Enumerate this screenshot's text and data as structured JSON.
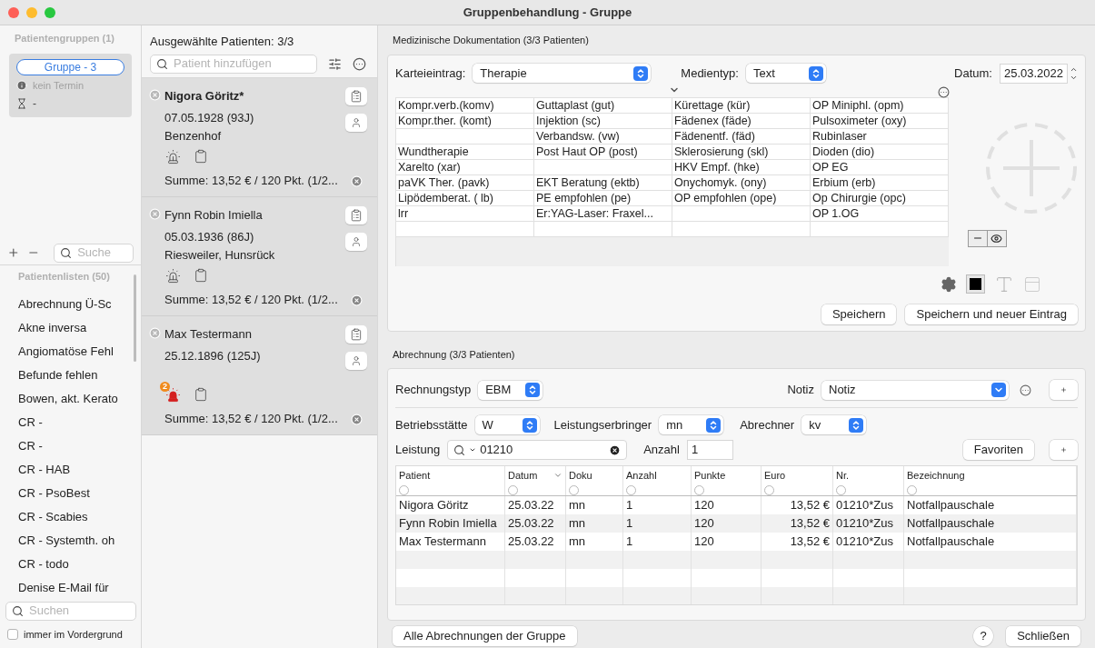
{
  "window": {
    "title": "Gruppenbehandlung - Gruppe"
  },
  "groups": {
    "header": "Patientengruppen (1)",
    "search_placeholder": "Suche",
    "items": [
      {
        "name": "Gruppe - 3",
        "selected": true,
        "appointment": "kein Termin",
        "info": "-"
      }
    ]
  },
  "lists": {
    "header": "Patientenlisten (50)",
    "search_placeholder": "Suchen",
    "items": [
      "Abrechnung Ü-Sc",
      "Akne inversa",
      "Angiomatöse Fehl",
      "Befunde fehlen",
      "Bowen, akt. Kerato",
      "CR -",
      "CR -",
      "CR - HAB",
      "CR - PsoBest",
      "CR - Scabies",
      "CR - Systemth. oh",
      "CR - todo",
      "Denise E-Mail für"
    ]
  },
  "always_on_top": {
    "label": "immer im Vordergrund",
    "checked": false
  },
  "selected_patients": {
    "title": "Ausgewählte Patienten: 3/3",
    "search_placeholder": "Patient hinzufügen",
    "patients": [
      {
        "name": "Nigora Göritz*",
        "selected": true,
        "birth": "07.05.1928 (93J)",
        "place": "Benzenhof",
        "alarm": false,
        "sum": "Summe: 13,52 € / 120 Pkt. (1/2..."
      },
      {
        "name": "Fynn Robin Imiella",
        "selected": false,
        "birth": "05.03.1936 (86J)",
        "place": "Riesweiler, Hunsrück",
        "alarm": false,
        "sum": "Summe: 13,52 € / 120 Pkt. (1/2..."
      },
      {
        "name": "Max Testermann",
        "selected": false,
        "birth": "25.12.1896 (125J)",
        "alarm": true,
        "alarm_count": "2",
        "sum": "Summe: 13,52 € / 120 Pkt. (1/2..."
      }
    ]
  },
  "documentation": {
    "title": "Medizinische Dokumentation (3/3 Patienten)",
    "entry_label": "Karteieintrag:",
    "entry_value": "Therapie",
    "media_label": "Medientyp:",
    "media_value": "Text",
    "date_label": "Datum:",
    "date_value": "25.03.2022",
    "shortcuts": [
      {
        "column_1": "Kompr.verb.(komv)",
        "column_2": "Guttaplast (gut)",
        "column_3": "Kürettage (kür)",
        "column_4": "OP Miniphl. (opm)"
      },
      {
        "column_1": "Kompr.ther. (komt)",
        "column_2": "Injektion (sc)",
        "column_3": "Fädenex (fäde)",
        "column_4": "Pulsoximeter (oxy)"
      },
      {
        "column_2": "Verbandsw. (vw)",
        "column_3": "Fädenentf. (fäd)",
        "column_4": "Rubinlaser"
      },
      {
        "column_1": "Wundtherapie",
        "column_2": "Post Haut OP (post)",
        "column_3": "Sklerosierung (skl)",
        "column_4": "Dioden (dio)"
      },
      {
        "column_1": "Xarelto (xar)",
        "column_3": "HKV Empf. (hke)",
        "column_4": "OP EG"
      },
      {
        "column_1": "paVK Ther. (pavk)",
        "column_2": "EKT Beratung (ektb)",
        "column_3": "Onychomyk. (ony)",
        "column_4": "Erbium (erb)"
      },
      {
        "column_1": "Lipödemberat. ( lb)",
        "column_2": "PE empfohlen (pe)",
        "column_3": "OP empfohlen (ope)",
        "column_4": "Op Chirurgie (opc)"
      },
      {
        "column_1": "lrr",
        "column_2": "Er:YAG-Laser: Fraxel...",
        "column_4": "OP 1.OG"
      }
    ],
    "buttons": [
      "Speichern",
      "Speichern und neuer Eintrag"
    ]
  },
  "billing": {
    "title": "Abrechnung (3/3 Patienten)",
    "invoice_type_label": "Rechnungstyp",
    "invoice_type": "EBM",
    "note_label": "Notiz",
    "note_value": "Notiz",
    "site_label": "Betriebsstätte",
    "site": "W",
    "provider_label": "Leistungserbringer",
    "provider": "mn",
    "biller_label": "Abrechner",
    "biller": "kv",
    "service_label": "Leistung",
    "service_value": "01210",
    "count_label": "Anzahl",
    "count_value": "1",
    "favorites": "Favoriten",
    "table": {
      "columns": [
        "Patient",
        "Datum",
        "Doku",
        "Anzahl",
        "Punkte",
        "Euro",
        "Nr.",
        "Bezeichnung"
      ],
      "rows": [
        [
          "Nigora Göritz",
          "25.03.22",
          "mn",
          "1",
          "120",
          "13,52 €",
          "01210*Zus",
          "Notfallpauschale"
        ],
        [
          "Fynn Robin Imiella",
          "25.03.22",
          "mn",
          "1",
          "120",
          "13,52 €",
          "01210*Zus",
          "Notfallpauschale"
        ],
        [
          "Max Testermann",
          "25.03.22",
          "mn",
          "1",
          "120",
          "13,52 €",
          "01210*Zus",
          "Notfallpauschale"
        ]
      ]
    }
  },
  "footer": {
    "all_billing": "Alle Abrechnungen der Gruppe",
    "help": "?",
    "close": "Schließen"
  }
}
